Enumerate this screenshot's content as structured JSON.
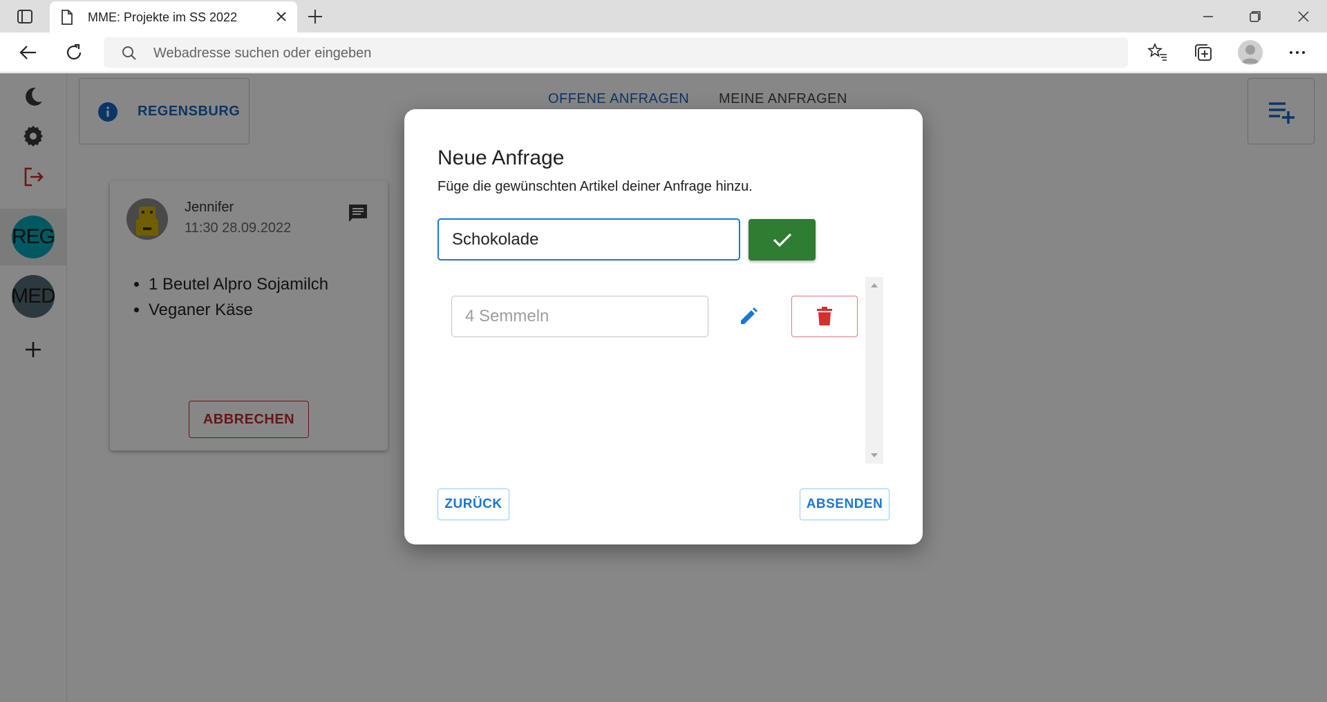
{
  "browser": {
    "tab_title": "MME: Projekte im SS 2022",
    "address_placeholder": "Webadresse suchen oder eingeben"
  },
  "app": {
    "location_label": "REGENSBURG",
    "nav": {
      "open_requests": "OFFENE ANFRAGEN",
      "my_requests": "MEINE ANFRAGEN"
    },
    "rail": {
      "groups": [
        {
          "label": "REG",
          "color": "#00a9b8"
        },
        {
          "label": "MED",
          "color": "#546e7a"
        }
      ]
    },
    "request_card": {
      "name": "Jennifer",
      "time": "11:30 28.09.2022",
      "items": [
        "1 Beutel Alpro Sojamilch",
        "Veganer Käse"
      ],
      "cancel_label": "ABBRECHEN"
    }
  },
  "dialog": {
    "title": "Neue Anfrage",
    "subtitle": "Füge die gewünschten Artikel deiner Anfrage hinzu.",
    "input_value": "Schokolade",
    "items": [
      {
        "value": "4 Semmeln"
      }
    ],
    "back_label": "ZURÜCK",
    "send_label": "ABSENDEN"
  },
  "colors": {
    "primary": "#1976d2",
    "success": "#2e7d32",
    "danger": "#d32f2f"
  }
}
